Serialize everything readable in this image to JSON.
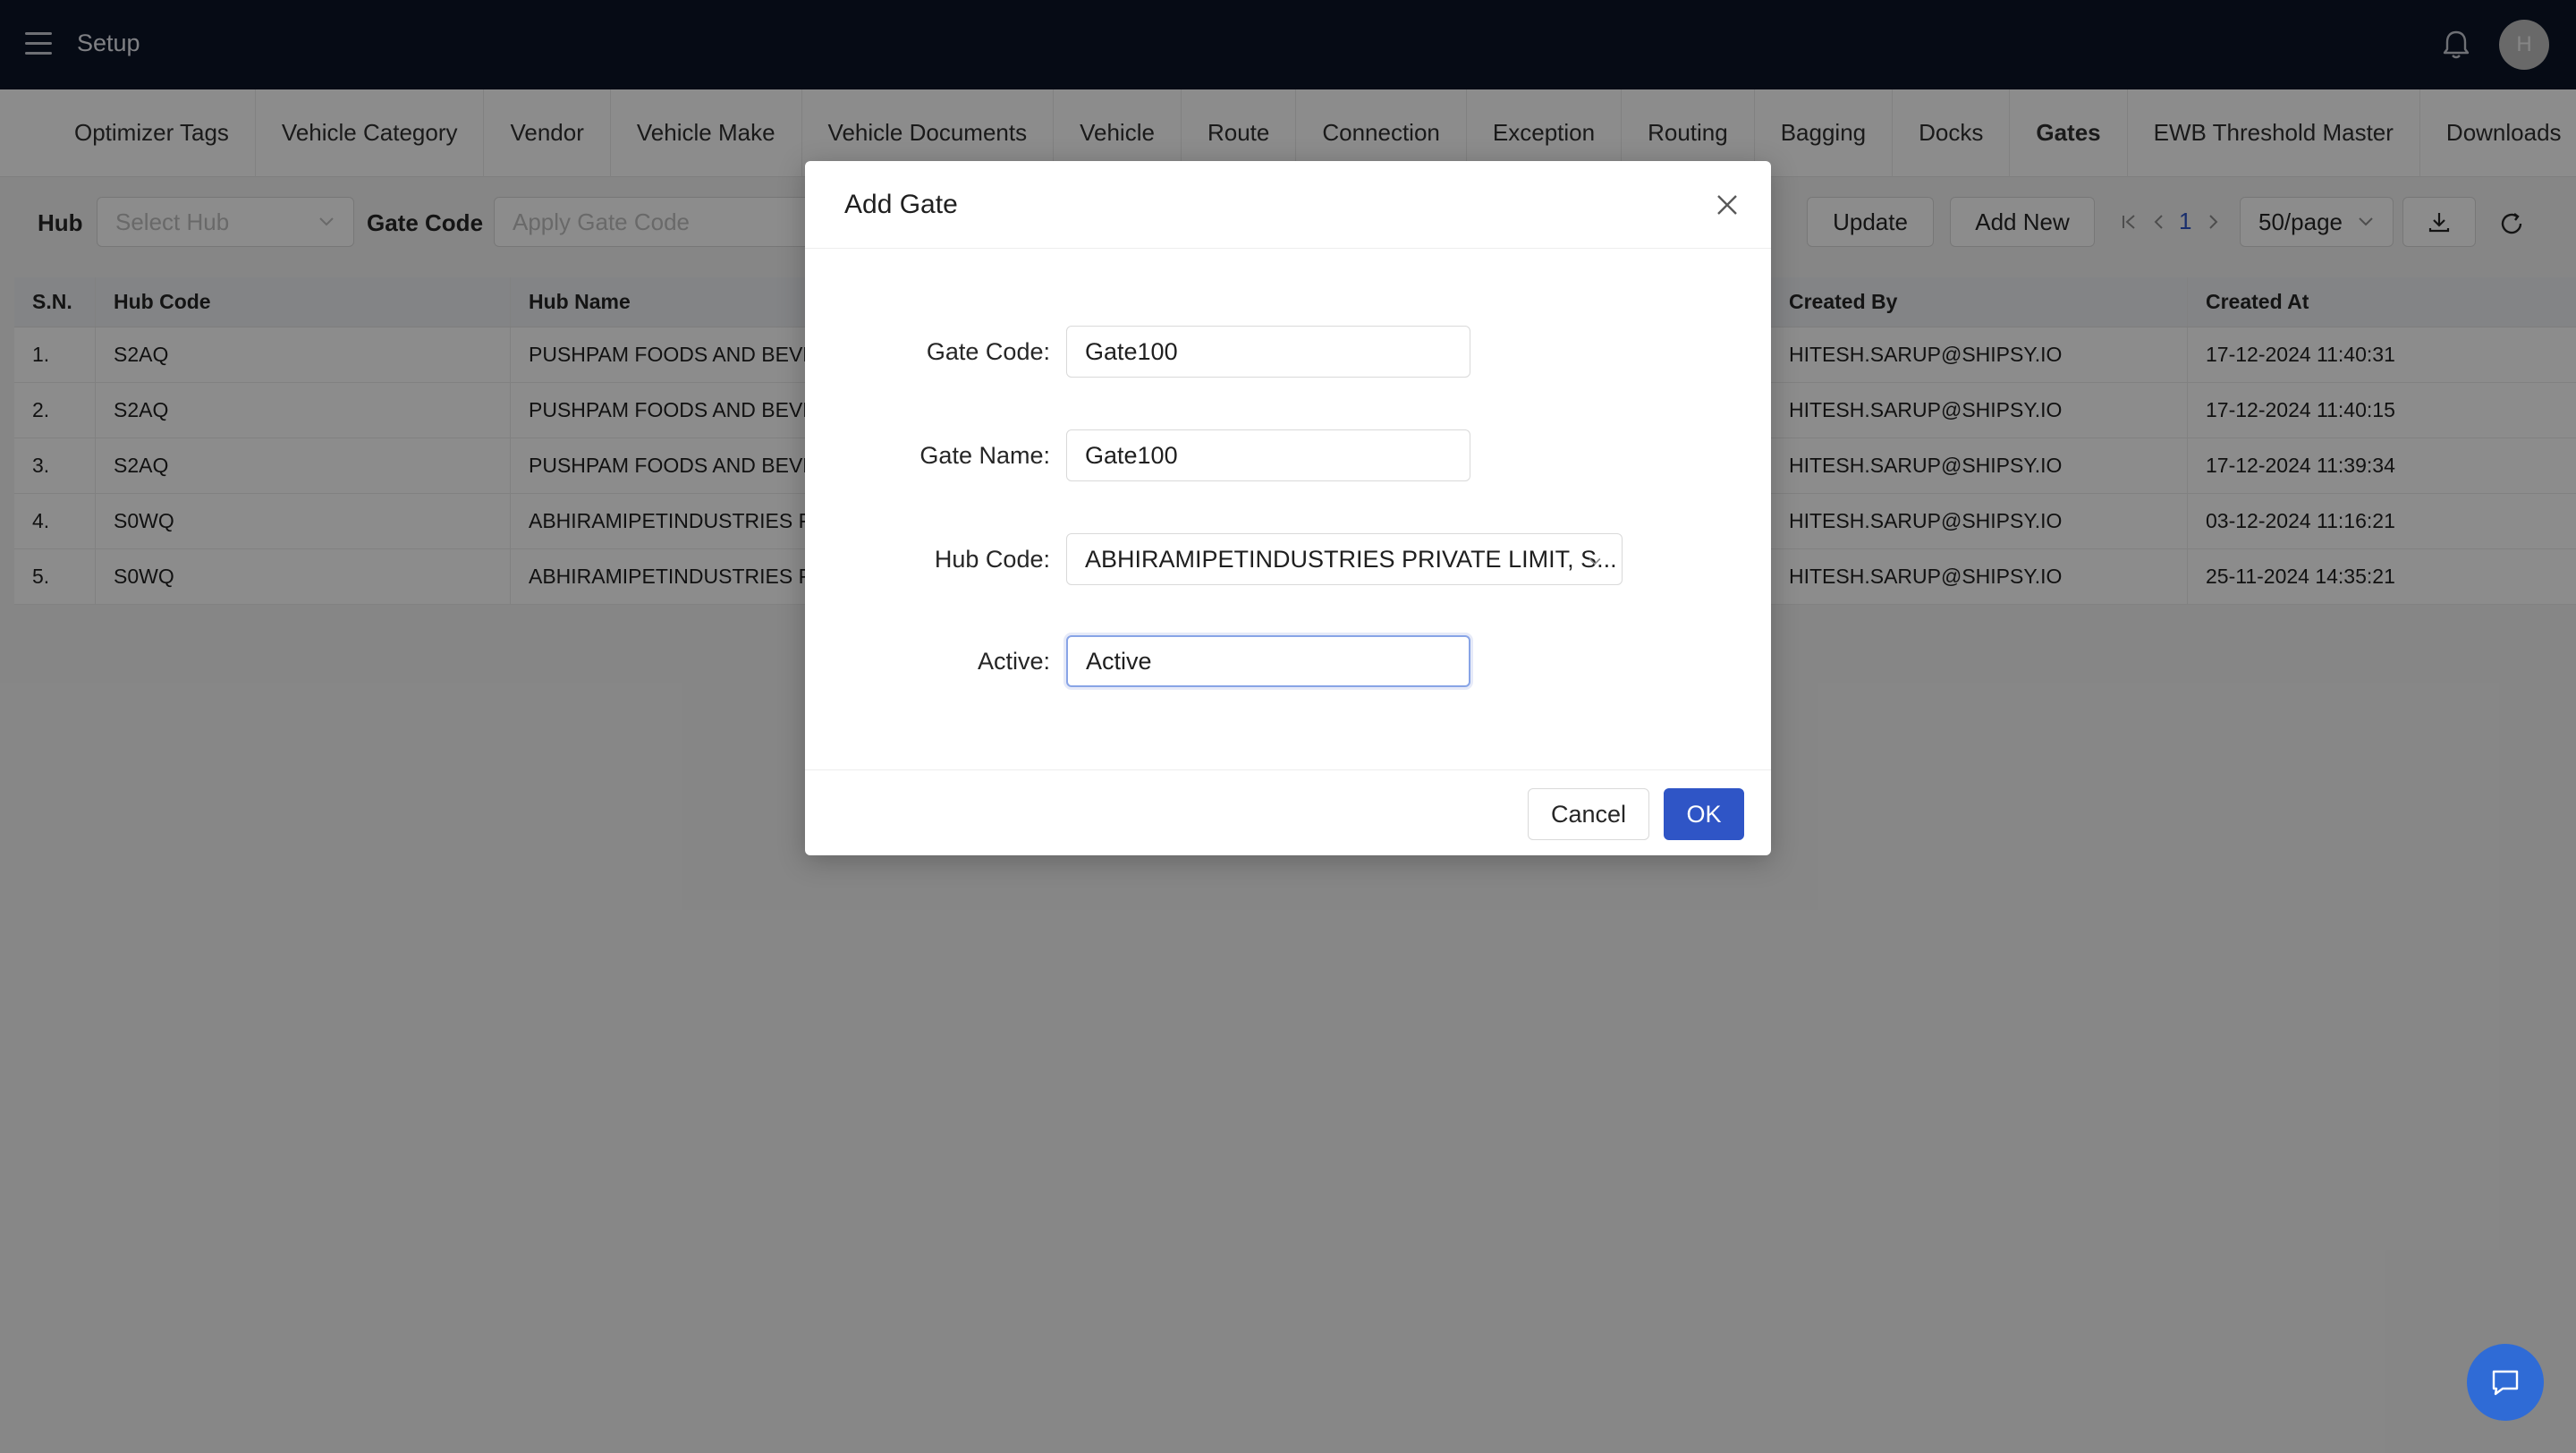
{
  "header": {
    "title": "Setup",
    "avatar_initial": "H",
    "icons": [
      "menu-icon",
      "bell-icon"
    ]
  },
  "tabs": [
    {
      "label": "Optimizer Tags"
    },
    {
      "label": "Vehicle Category"
    },
    {
      "label": "Vendor"
    },
    {
      "label": "Vehicle Make"
    },
    {
      "label": "Vehicle Documents"
    },
    {
      "label": "Vehicle"
    },
    {
      "label": "Route"
    },
    {
      "label": "Connection"
    },
    {
      "label": "Exception"
    },
    {
      "label": "Routing"
    },
    {
      "label": "Bagging"
    },
    {
      "label": "Docks"
    },
    {
      "label": "Gates",
      "active": true
    },
    {
      "label": "EWB Threshold Master"
    },
    {
      "label": "Downloads"
    }
  ],
  "filters": {
    "hub_label": "Hub",
    "hub_placeholder": "Select Hub",
    "gate_code_label": "Gate Code",
    "gate_code_placeholder": "Apply Gate Code",
    "update_label": "Update",
    "add_new_label": "Add New",
    "page_number": "1",
    "page_size": "50/page"
  },
  "table": {
    "columns": [
      "S.N.",
      "Hub Code",
      "Hub Name",
      "Created By",
      "Created At"
    ],
    "rows": [
      [
        "1.",
        "S2AQ",
        "PUSHPAM FOODS AND BEVEI",
        "HITESH.SARUP@SHIPSY.IO",
        "17-12-2024 11:40:31"
      ],
      [
        "2.",
        "S2AQ",
        "PUSHPAM FOODS AND BEVEI",
        "HITESH.SARUP@SHIPSY.IO",
        "17-12-2024 11:40:15"
      ],
      [
        "3.",
        "S2AQ",
        "PUSHPAM FOODS AND BEVEI",
        "HITESH.SARUP@SHIPSY.IO",
        "17-12-2024 11:39:34"
      ],
      [
        "4.",
        "S0WQ",
        "ABHIRAMIPETINDUSTRIES PR",
        "HITESH.SARUP@SHIPSY.IO",
        "03-12-2024 11:16:21"
      ],
      [
        "5.",
        "S0WQ",
        "ABHIRAMIPETINDUSTRIES PR",
        "HITESH.SARUP@SHIPSY.IO",
        "25-11-2024 14:35:21"
      ]
    ]
  },
  "modal": {
    "title": "Add Gate",
    "gate_code_label": "Gate Code",
    "gate_code_value": "Gate100",
    "gate_name_label": "Gate Name",
    "gate_name_value": "Gate100",
    "hub_code_label": "Hub Code",
    "hub_code_value": "ABHIRAMIPETINDUSTRIES PRIVATE LIMIT, S...",
    "active_label": "Active",
    "active_value": "Active",
    "cancel_label": "Cancel",
    "ok_label": "OK"
  },
  "colors": {
    "topbar": "#0c1527",
    "primary": "#2f55c6",
    "chat": "#2f6bd6"
  }
}
